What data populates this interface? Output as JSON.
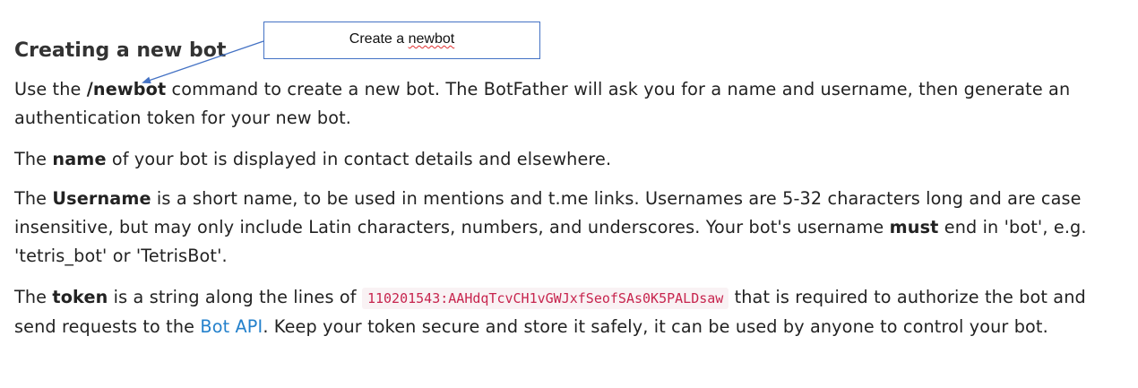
{
  "heading": "Creating a new bot",
  "callout": {
    "text_before": "Create a ",
    "squiggle_word": "newbot"
  },
  "p1": {
    "t1": "Use the ",
    "command": "/newbot",
    "t2": " command to create a new bot. The BotFather will ask you for a name and username, then generate an authentication token for your new bot."
  },
  "p2": {
    "t1": "The ",
    "bold": "name",
    "t2": " of your bot is displayed in contact details and elsewhere."
  },
  "p3": {
    "t1": "The ",
    "bold1": "Username",
    "t2": " is a short name, to be used in mentions and t.me links. Usernames are 5-32 characters long and are case insensitive, but may only include Latin characters, numbers, and underscores. Your bot's username ",
    "bold2": "must",
    "t3": " end in 'bot', e.g. 'tetris_bot' or 'TetrisBot'."
  },
  "p4": {
    "t1": "The ",
    "bold": "token",
    "t2": " is a string along the lines of ",
    "code": "110201543:AAHdqTcvCH1vGWJxfSeofSAs0K5PALDsaw",
    "t3": " that is required to authorize the bot and send requests to the ",
    "link": "Bot API",
    "t4": ". Keep your token secure and store it safely, it can be used by anyone to control your bot."
  },
  "colors": {
    "text": "#222222",
    "link": "#2481cc",
    "code": "#c7254e",
    "code_bg": "#f9f2f4",
    "callout_border": "#4472c4"
  }
}
